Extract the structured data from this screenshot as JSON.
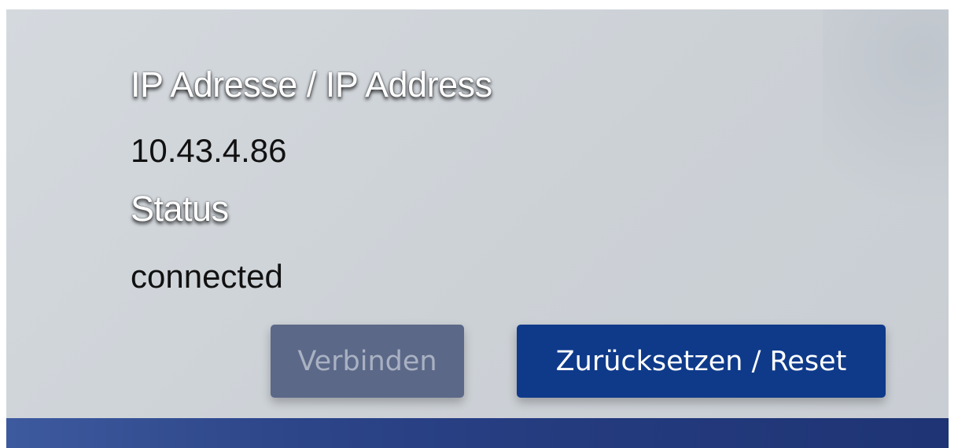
{
  "network": {
    "ip_label": "IP Adresse / IP Address",
    "ip_value": "10.43.4.86",
    "status_label": "Status",
    "status_value": "connected"
  },
  "actions": {
    "connect_label": "Verbinden",
    "connect_enabled": false,
    "reset_label": "Zurücksetzen / Reset"
  },
  "colors": {
    "panel_background": "#ccd1d6",
    "connect_button_disabled": "#5b6888",
    "reset_button": "#0f3a8a",
    "footer_bar": "#243b7e"
  }
}
